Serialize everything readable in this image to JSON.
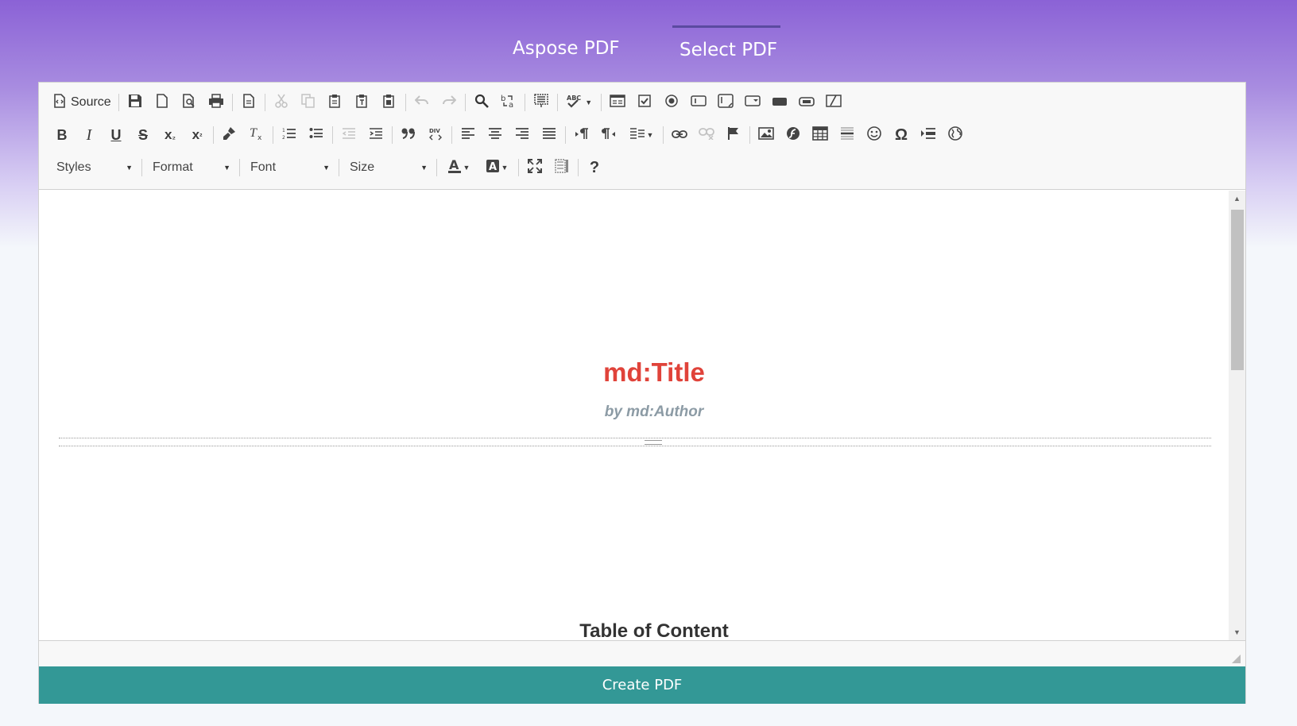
{
  "tabs": [
    {
      "label": "Aspose PDF"
    },
    {
      "label": "Select PDF"
    }
  ],
  "toolbar": {
    "source_label": "Source",
    "styles_label": "Styles",
    "format_label": "Format",
    "font_label": "Font",
    "size_label": "Size",
    "help_label": "?",
    "omega_label": "Ω"
  },
  "document": {
    "title": "md:Title",
    "author": "by md:Author",
    "toc_heading": "Table of Content"
  },
  "actions": {
    "create_label": "Create PDF"
  },
  "colors": {
    "accent": "#339896",
    "title": "#e0433a",
    "author": "#8c9ba5",
    "header_top": "#8b62d6"
  }
}
